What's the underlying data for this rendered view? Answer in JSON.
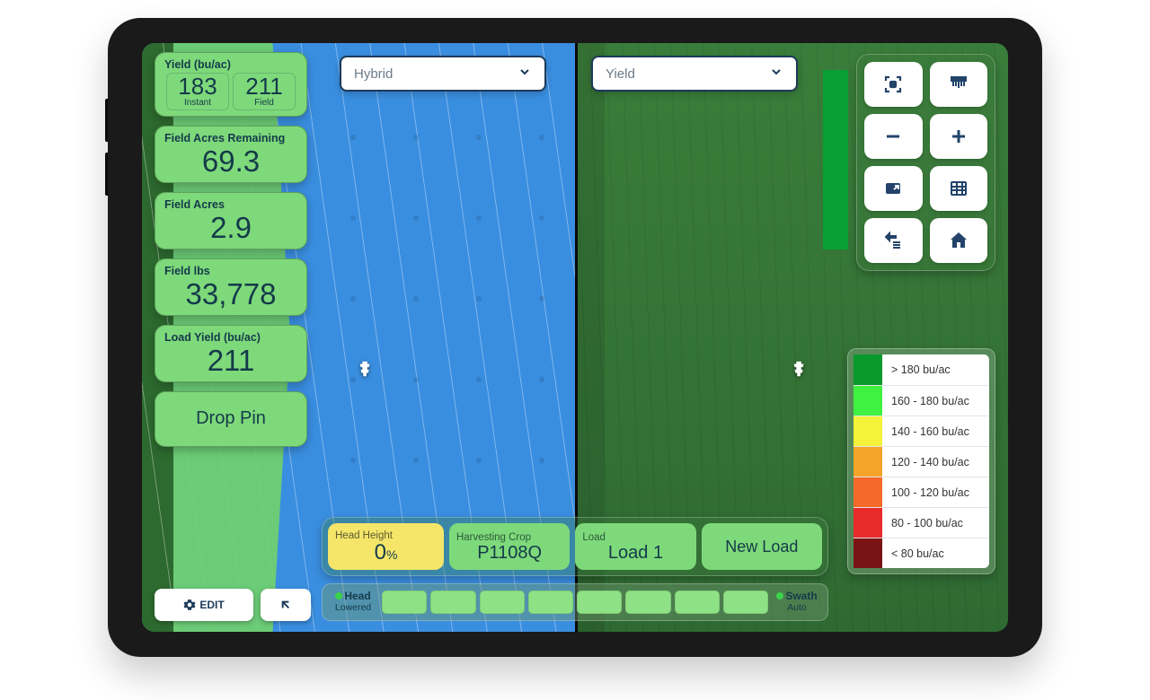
{
  "cards": {
    "yield": {
      "title": "Yield (bu/ac)",
      "instant_value": "183",
      "instant_label": "Instant",
      "field_value": "211",
      "field_label": "Field"
    },
    "acres_remaining": {
      "title": "Field Acres Remaining",
      "value": "69.3"
    },
    "field_acres": {
      "title": "Field Acres",
      "value": "2.9"
    },
    "field_lbs": {
      "title": "Field lbs",
      "value": "33,778"
    },
    "load_yield": {
      "title": "Load Yield (bu/ac)",
      "value": "211"
    },
    "drop_pin": "Drop Pin"
  },
  "edit": {
    "label": "EDIT"
  },
  "dropdowns": {
    "left": "Hybrid",
    "right": "Yield"
  },
  "toolbar_icons": [
    "focus-icon",
    "header-icon",
    "minus-icon",
    "plus-icon",
    "layer-icon",
    "grid-icon",
    "swap-icon",
    "home-icon"
  ],
  "legend": [
    {
      "color": "#0a9a2c",
      "label": "> 180 bu/ac"
    },
    {
      "color": "#3ff241",
      "label": "160 - 180 bu/ac"
    },
    {
      "color": "#f6f23a",
      "label": "140 - 160 bu/ac"
    },
    {
      "color": "#f5a329",
      "label": "120 - 140 bu/ac"
    },
    {
      "color": "#f56a29",
      "label": "100 - 120 bu/ac"
    },
    {
      "color": "#e92a2a",
      "label": "80 - 100 bu/ac"
    },
    {
      "color": "#7a1414",
      "label": "< 80 bu/ac"
    }
  ],
  "bottom": {
    "head_height": {
      "label": "Head Height",
      "value": "0",
      "unit": "%"
    },
    "crop": {
      "label": "Harvesting Crop",
      "value": "P1108Q"
    },
    "load": {
      "label": "Load",
      "value": "Load 1"
    },
    "new_load": "New Load"
  },
  "swath": {
    "head_title": "Head",
    "head_sub": "Lowered",
    "swath_title": "Swath",
    "swath_sub": "Auto",
    "segments": 8
  }
}
